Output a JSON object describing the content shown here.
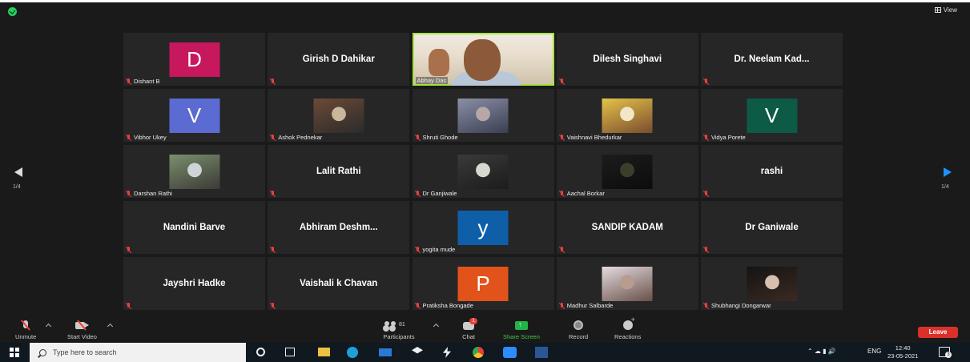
{
  "header": {
    "view_label": "View"
  },
  "tiles": [
    {
      "display": "letter",
      "letter": "D",
      "color": "#c8185d",
      "name": "Dishant B"
    },
    {
      "display": "name",
      "name": "Girish D Dahikar"
    },
    {
      "display": "video",
      "name": "Abhay Das",
      "active": true
    },
    {
      "display": "name",
      "name": "Dilesh Singhavi"
    },
    {
      "display": "name",
      "name": "Dr.  Neelam  Kad..."
    },
    {
      "display": "letter",
      "letter": "V",
      "color": "#5b6bd1",
      "name": "Vibhor Ukey"
    },
    {
      "display": "photo",
      "photo": "man-in-suit",
      "palette": [
        "#6b4a36",
        "#c9b79c",
        "#2b2b2b"
      ],
      "name": "Ashok Pednekar"
    },
    {
      "display": "photo",
      "photo": "sky",
      "palette": [
        "#8a8fa6",
        "#b7a7a7",
        "#3a3f52"
      ],
      "name": "Shruti Ghode"
    },
    {
      "display": "photo",
      "photo": "woman-yellow",
      "palette": [
        "#e4c34a",
        "#f2e6c8",
        "#7a4c2e"
      ],
      "name": "Vaishnavi Bhedurkar"
    },
    {
      "display": "letter",
      "letter": "V",
      "color": "#0d5a46",
      "name": "Vidya Porete"
    },
    {
      "display": "photo",
      "photo": "man-outdoor",
      "palette": [
        "#7a8f6e",
        "#cfd4d8",
        "#3d3a36"
      ],
      "name": "Darshan Rathi"
    },
    {
      "display": "name",
      "name": "Lalit Rathi"
    },
    {
      "display": "photo",
      "photo": "dim-light",
      "palette": [
        "#3a3a3a",
        "#d8d8d0",
        "#1c1c1c"
      ],
      "name": "Dr Ganjiwale"
    },
    {
      "display": "photo",
      "photo": "night",
      "palette": [
        "#1c1c1c",
        "#3d3d2c",
        "#0c0c0c"
      ],
      "name": "Aachal Borkar"
    },
    {
      "display": "name",
      "name": "rashi"
    },
    {
      "display": "name",
      "name": "Nandini Barve"
    },
    {
      "display": "name",
      "name": "Abhiram  Deshm..."
    },
    {
      "display": "letter",
      "letter": "y",
      "color": "#0f5fa8",
      "name": "yogita mude"
    },
    {
      "display": "name",
      "name": "SANDIP KADAM"
    },
    {
      "display": "name",
      "name": "Dr Ganiwale"
    },
    {
      "display": "name",
      "name": "Jayshri Hadke"
    },
    {
      "display": "name",
      "name": "Vaishali k Chavan"
    },
    {
      "display": "letter",
      "letter": "P",
      "color": "#e2531b",
      "name": "Pratiksha Bongade"
    },
    {
      "display": "photo",
      "photo": "woman-light",
      "palette": [
        "#e3dbe0",
        "#b89c8e",
        "#6a5048"
      ],
      "name": "Madhur Salbarde"
    },
    {
      "display": "photo",
      "photo": "woman-dark",
      "palette": [
        "#141414",
        "#d7c0b0",
        "#3b2a22"
      ],
      "name": "Shubhangi Dongarwar"
    }
  ],
  "pagination": {
    "left": "1/4",
    "right": "1/4"
  },
  "toolbar": {
    "unmute": "Unmute",
    "start_video": "Start Video",
    "participants": "Participants",
    "participants_count": "81",
    "chat": "Chat",
    "chat_badge": "1",
    "share_screen": "Share Screen",
    "record": "Record",
    "reactions": "Reactions",
    "leave": "Leave"
  },
  "taskbar": {
    "search_placeholder": "Type here to search",
    "language": "ENG",
    "time": "12:40",
    "date": "23-05-2021",
    "notifications": "3"
  }
}
